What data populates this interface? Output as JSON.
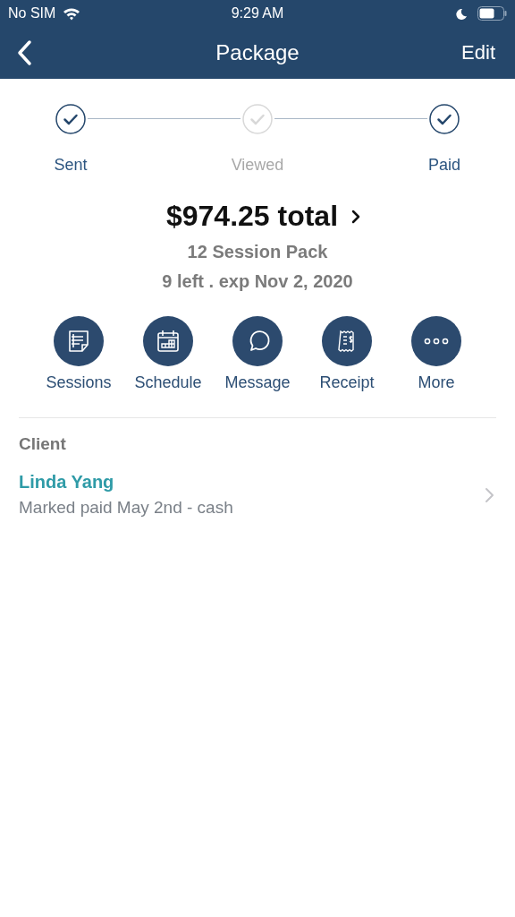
{
  "status_bar": {
    "carrier": "No SIM",
    "time": "9:29 AM"
  },
  "nav": {
    "title": "Package",
    "action": "Edit"
  },
  "steps": [
    {
      "label": "Sent",
      "done": true
    },
    {
      "label": "Viewed",
      "done": false
    },
    {
      "label": "Paid",
      "done": true
    }
  ],
  "summary": {
    "total": "$974.25 total",
    "name": "12 Session Pack",
    "detail": "9 left . exp Nov 2, 2020"
  },
  "actions": [
    {
      "kind": "sessions",
      "label": "Sessions"
    },
    {
      "kind": "schedule",
      "label": "Schedule"
    },
    {
      "kind": "message",
      "label": "Message"
    },
    {
      "kind": "receipt",
      "label": "Receipt"
    },
    {
      "kind": "more",
      "label": "More"
    }
  ],
  "client": {
    "heading": "Client",
    "name": "Linda Yang",
    "note": "Marked paid May 2nd - cash"
  }
}
